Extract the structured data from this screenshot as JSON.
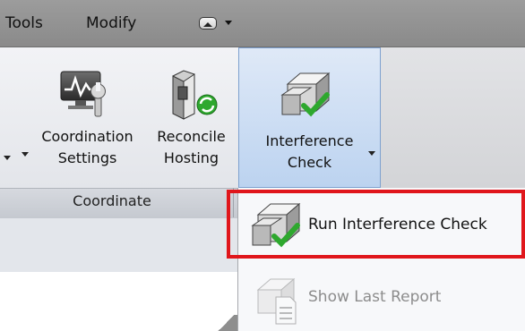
{
  "menu": {
    "tabs": [
      {
        "label": "Tools"
      },
      {
        "label": "Modify"
      }
    ]
  },
  "ribbon": {
    "panel_title": "Coordinate",
    "buttons": {
      "coordination_settings": {
        "line1": "Coordination",
        "line2": "Settings",
        "icon": "monitor-wrench-icon"
      },
      "reconcile_hosting": {
        "line1": "Reconcile",
        "line2": "Hosting",
        "icon": "reconcile-hosting-icon"
      },
      "interference_check": {
        "line1": "Interference",
        "line2": "Check",
        "icon": "interference-check-icon"
      }
    }
  },
  "dropdown": {
    "items": [
      {
        "label": "Run Interference Check",
        "icon": "interference-check-icon",
        "enabled": true
      },
      {
        "label": "Show Last Report",
        "icon": "report-icon",
        "enabled": false
      }
    ]
  },
  "colors": {
    "highlight": "#e0161b",
    "active_button": "#bcd3f0",
    "check_green": "#2ea82e"
  }
}
